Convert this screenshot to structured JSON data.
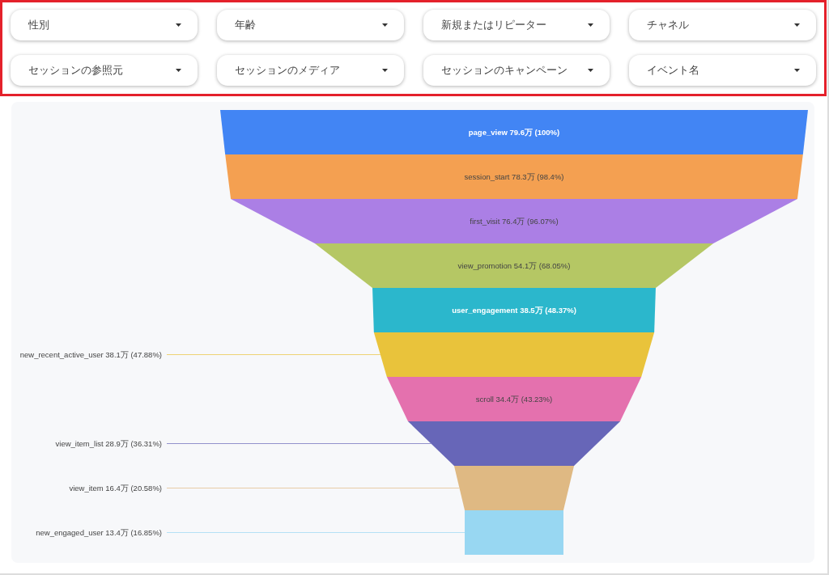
{
  "filters": [
    {
      "label": "性別"
    },
    {
      "label": "年齢"
    },
    {
      "label": "新規またはリピーター"
    },
    {
      "label": "チャネル"
    },
    {
      "label": "セッションの参照元"
    },
    {
      "label": "セッションのメディア"
    },
    {
      "label": "セッションのキャンペーン"
    },
    {
      "label": "イベント名"
    }
  ],
  "funnel": {
    "stages": [
      {
        "label": "page_view 79.6万 (100%)",
        "color": "#4285f4",
        "kind": "inside",
        "bold": true
      },
      {
        "label": "session_start 78.3万 (98.4%)",
        "color": "#f4a051",
        "kind": "inside",
        "bold": false
      },
      {
        "label": "first_visit 76.4万 (96.07%)",
        "color": "#ab7fe5",
        "kind": "inside",
        "bold": false
      },
      {
        "label": "view_promotion 54.1万 (68.05%)",
        "color": "#b5c764",
        "kind": "inside",
        "bold": false
      },
      {
        "label": "user_engagement 38.5万 (48.37%)",
        "color": "#2bb7cc",
        "kind": "inside",
        "bold": true
      },
      {
        "label": "new_recent_active_user 38.1万 (47.88%)",
        "color": "#e9c33b",
        "kind": "outside",
        "bold": false
      },
      {
        "label": "scroll 34.4万 (43.23%)",
        "color": "#e471ae",
        "kind": "inside",
        "bold": false
      },
      {
        "label": "view_item_list 28.9万 (36.31%)",
        "color": "#6766b8",
        "kind": "outside",
        "bold": false
      },
      {
        "label": "view_item 16.4万 (20.58%)",
        "color": "#dfb983",
        "kind": "outside",
        "bold": false
      },
      {
        "label": "new_engaged_user 13.4万 (16.85%)",
        "color": "#98d7f2",
        "kind": "outside",
        "bold": false
      }
    ]
  }
}
